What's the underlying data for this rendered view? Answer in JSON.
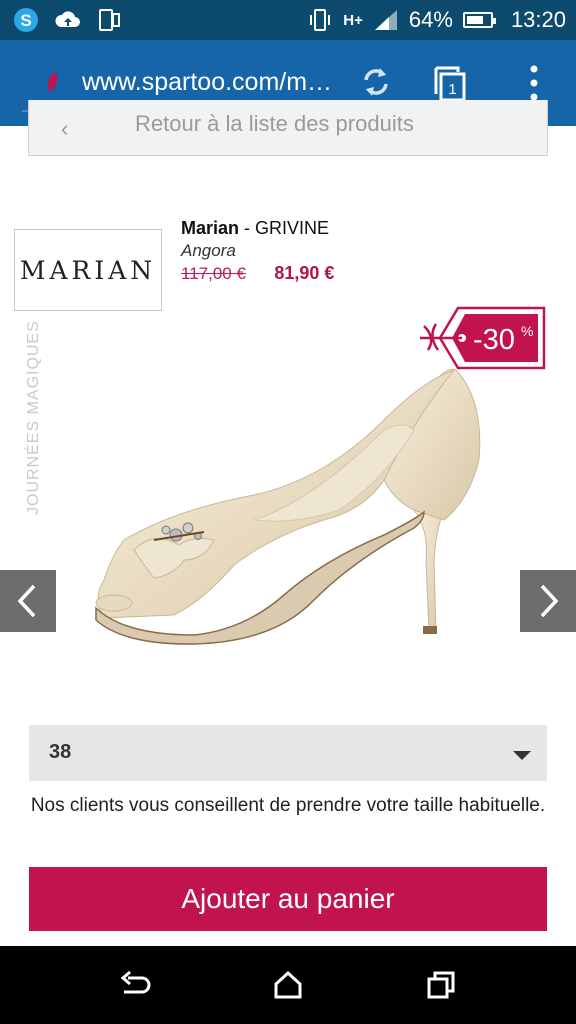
{
  "status_bar": {
    "battery": "64%",
    "time": "13:20",
    "network": "H+",
    "icons": [
      "skype-icon",
      "cloud-upload-icon",
      "screen-share-icon",
      "vibrate-icon",
      "signal-icon",
      "battery-icon"
    ]
  },
  "browser": {
    "url": "www.spartoo.com/m…",
    "tab_count": "1"
  },
  "back_link": {
    "label": "Retour à la liste des produits"
  },
  "product": {
    "brand_logo_text": "MARIAN",
    "brand": "Marian",
    "model": " - GRIVINE",
    "color": "Angora",
    "old_price": "117,00 €",
    "new_price": "81,90 €",
    "discount": "-30",
    "discount_suffix": "%",
    "promo_watermark": "JOURNÉES MAGIQUES"
  },
  "size_select": {
    "selected": "38"
  },
  "advice_text": "Nos clients vous conseillent de prendre votre taille habituelle.",
  "add_to_cart_label": "Ajouter au panier",
  "colors": {
    "status_bar": "#0c4a6e",
    "browser_bar": "#1565a8",
    "accent": "#c1134e"
  }
}
